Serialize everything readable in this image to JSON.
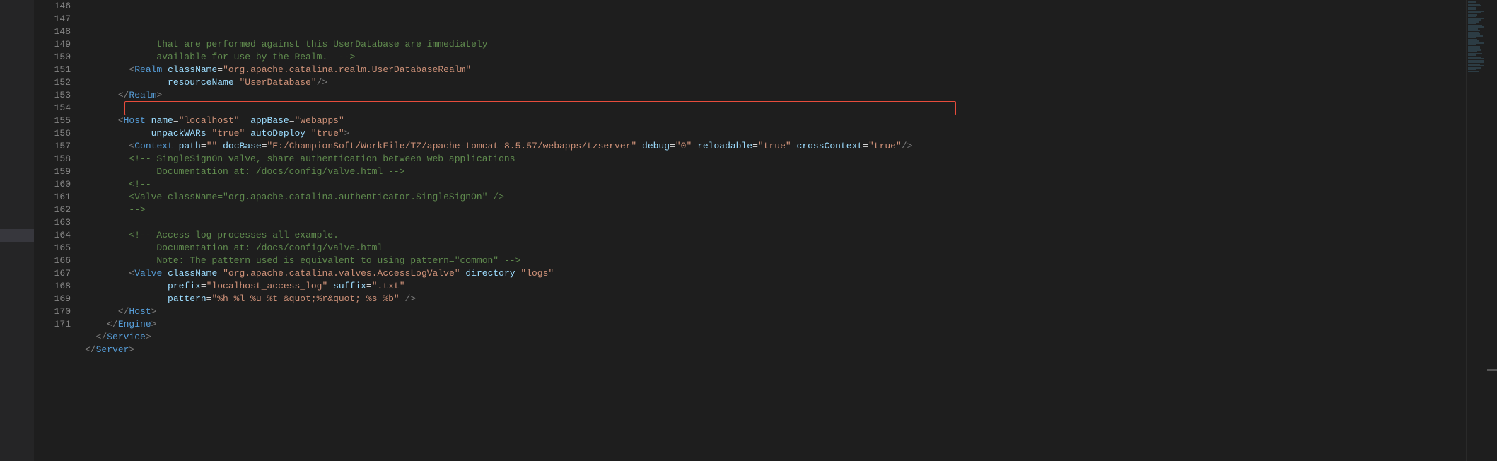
{
  "lines": [
    {
      "num": "146",
      "indent": "             ",
      "tokens": [
        {
          "t": "that are performed against this UserDatabase are immediately",
          "c": "c-comment"
        }
      ]
    },
    {
      "num": "147",
      "indent": "             ",
      "tokens": [
        {
          "t": "available for use by the Realm.  -->",
          "c": "c-comment"
        }
      ]
    },
    {
      "num": "148",
      "indent": "        ",
      "tokens": [
        {
          "t": "<",
          "c": "c-punct"
        },
        {
          "t": "Realm",
          "c": "c-tag"
        },
        {
          "t": " ",
          "c": "c-text"
        },
        {
          "t": "className",
          "c": "c-attr"
        },
        {
          "t": "=",
          "c": "c-text"
        },
        {
          "t": "\"org.apache.catalina.realm.UserDatabaseRealm\"",
          "c": "c-string"
        }
      ]
    },
    {
      "num": "149",
      "indent": "               ",
      "tokens": [
        {
          "t": "resourceName",
          "c": "c-attr"
        },
        {
          "t": "=",
          "c": "c-text"
        },
        {
          "t": "\"UserDatabase\"",
          "c": "c-string"
        },
        {
          "t": "/>",
          "c": "c-punct"
        }
      ]
    },
    {
      "num": "150",
      "indent": "      ",
      "tokens": [
        {
          "t": "</",
          "c": "c-punct"
        },
        {
          "t": "Realm",
          "c": "c-tag"
        },
        {
          "t": ">",
          "c": "c-punct"
        }
      ]
    },
    {
      "num": "151",
      "indent": "",
      "tokens": []
    },
    {
      "num": "152",
      "indent": "      ",
      "tokens": [
        {
          "t": "<",
          "c": "c-punct"
        },
        {
          "t": "Host",
          "c": "c-tag"
        },
        {
          "t": " ",
          "c": "c-text"
        },
        {
          "t": "name",
          "c": "c-attr"
        },
        {
          "t": "=",
          "c": "c-text"
        },
        {
          "t": "\"localhost\"",
          "c": "c-string"
        },
        {
          "t": "  ",
          "c": "c-text"
        },
        {
          "t": "appBase",
          "c": "c-attr"
        },
        {
          "t": "=",
          "c": "c-text"
        },
        {
          "t": "\"webapps\"",
          "c": "c-string"
        }
      ]
    },
    {
      "num": "153",
      "indent": "            ",
      "tokens": [
        {
          "t": "unpackWARs",
          "c": "c-attr"
        },
        {
          "t": "=",
          "c": "c-text"
        },
        {
          "t": "\"true\"",
          "c": "c-string"
        },
        {
          "t": " ",
          "c": "c-text"
        },
        {
          "t": "autoDeploy",
          "c": "c-attr"
        },
        {
          "t": "=",
          "c": "c-text"
        },
        {
          "t": "\"true\"",
          "c": "c-string"
        },
        {
          "t": ">",
          "c": "c-punct"
        }
      ]
    },
    {
      "num": "154",
      "indent": "        ",
      "tokens": [
        {
          "t": "<",
          "c": "c-punct"
        },
        {
          "t": "Context",
          "c": "c-tag"
        },
        {
          "t": " ",
          "c": "c-text"
        },
        {
          "t": "path",
          "c": "c-attr"
        },
        {
          "t": "=",
          "c": "c-text"
        },
        {
          "t": "\"\"",
          "c": "c-string"
        },
        {
          "t": " ",
          "c": "c-text"
        },
        {
          "t": "docBase",
          "c": "c-attr"
        },
        {
          "t": "=",
          "c": "c-text"
        },
        {
          "t": "\"E:/ChampionSoft/WorkFile/TZ/apache-tomcat-8.5.57/webapps/tzserver\"",
          "c": "c-string"
        },
        {
          "t": " ",
          "c": "c-text"
        },
        {
          "t": "debug",
          "c": "c-attr"
        },
        {
          "t": "=",
          "c": "c-text"
        },
        {
          "t": "\"0\"",
          "c": "c-string"
        },
        {
          "t": " ",
          "c": "c-text"
        },
        {
          "t": "reloadable",
          "c": "c-attr"
        },
        {
          "t": "=",
          "c": "c-text"
        },
        {
          "t": "\"true\"",
          "c": "c-string"
        },
        {
          "t": " ",
          "c": "c-text"
        },
        {
          "t": "crossContext",
          "c": "c-attr"
        },
        {
          "t": "=",
          "c": "c-text"
        },
        {
          "t": "\"true\"",
          "c": "c-string"
        },
        {
          "t": "/>",
          "c": "c-punct"
        }
      ]
    },
    {
      "num": "155",
      "indent": "        ",
      "tokens": [
        {
          "t": "<!-- SingleSignOn valve, share authentication between web applications",
          "c": "c-comment"
        }
      ]
    },
    {
      "num": "156",
      "indent": "             ",
      "tokens": [
        {
          "t": "Documentation at: /docs/config/valve.html -->",
          "c": "c-comment"
        }
      ]
    },
    {
      "num": "157",
      "indent": "        ",
      "tokens": [
        {
          "t": "<!--",
          "c": "c-comment"
        }
      ]
    },
    {
      "num": "158",
      "indent": "        ",
      "tokens": [
        {
          "t": "<Valve className=\"org.apache.catalina.authenticator.SingleSignOn\" />",
          "c": "c-comment"
        }
      ]
    },
    {
      "num": "159",
      "indent": "        ",
      "tokens": [
        {
          "t": "-->",
          "c": "c-comment"
        }
      ]
    },
    {
      "num": "160",
      "indent": "",
      "tokens": []
    },
    {
      "num": "161",
      "indent": "        ",
      "tokens": [
        {
          "t": "<!-- Access log processes all example.",
          "c": "c-comment"
        }
      ]
    },
    {
      "num": "162",
      "indent": "             ",
      "tokens": [
        {
          "t": "Documentation at: /docs/config/valve.html",
          "c": "c-comment"
        }
      ]
    },
    {
      "num": "163",
      "indent": "             ",
      "tokens": [
        {
          "t": "Note: The pattern used is equivalent to using pattern=\"common\" -->",
          "c": "c-comment"
        }
      ]
    },
    {
      "num": "164",
      "indent": "        ",
      "tokens": [
        {
          "t": "<",
          "c": "c-punct"
        },
        {
          "t": "Valve",
          "c": "c-tag"
        },
        {
          "t": " ",
          "c": "c-text"
        },
        {
          "t": "className",
          "c": "c-attr"
        },
        {
          "t": "=",
          "c": "c-text"
        },
        {
          "t": "\"org.apache.catalina.valves.AccessLogValve\"",
          "c": "c-string"
        },
        {
          "t": " ",
          "c": "c-text"
        },
        {
          "t": "directory",
          "c": "c-attr"
        },
        {
          "t": "=",
          "c": "c-text"
        },
        {
          "t": "\"logs\"",
          "c": "c-string"
        }
      ]
    },
    {
      "num": "165",
      "indent": "               ",
      "tokens": [
        {
          "t": "prefix",
          "c": "c-attr"
        },
        {
          "t": "=",
          "c": "c-text"
        },
        {
          "t": "\"localhost_access_log\"",
          "c": "c-string"
        },
        {
          "t": " ",
          "c": "c-text"
        },
        {
          "t": "suffix",
          "c": "c-attr"
        },
        {
          "t": "=",
          "c": "c-text"
        },
        {
          "t": "\".txt\"",
          "c": "c-string"
        }
      ]
    },
    {
      "num": "166",
      "indent": "               ",
      "tokens": [
        {
          "t": "pattern",
          "c": "c-attr"
        },
        {
          "t": "=",
          "c": "c-text"
        },
        {
          "t": "\"%h %l %u %t &quot;%r&quot; %s %b\"",
          "c": "c-string"
        },
        {
          "t": " />",
          "c": "c-punct"
        }
      ]
    },
    {
      "num": "167",
      "indent": "      ",
      "tokens": [
        {
          "t": "</",
          "c": "c-punct"
        },
        {
          "t": "Host",
          "c": "c-tag"
        },
        {
          "t": ">",
          "c": "c-punct"
        }
      ]
    },
    {
      "num": "168",
      "indent": "    ",
      "tokens": [
        {
          "t": "</",
          "c": "c-punct"
        },
        {
          "t": "Engine",
          "c": "c-tag"
        },
        {
          "t": ">",
          "c": "c-punct"
        }
      ]
    },
    {
      "num": "169",
      "indent": "  ",
      "tokens": [
        {
          "t": "</",
          "c": "c-punct"
        },
        {
          "t": "Service",
          "c": "c-tag"
        },
        {
          "t": ">",
          "c": "c-punct"
        }
      ]
    },
    {
      "num": "170",
      "indent": "",
      "tokens": [
        {
          "t": "</",
          "c": "c-punct"
        },
        {
          "t": "Server",
          "c": "c-tag"
        },
        {
          "t": ">",
          "c": "c-punct"
        }
      ]
    },
    {
      "num": "171",
      "indent": "",
      "tokens": []
    }
  ],
  "highlight_line_index": 8,
  "minimap_lines": 40
}
